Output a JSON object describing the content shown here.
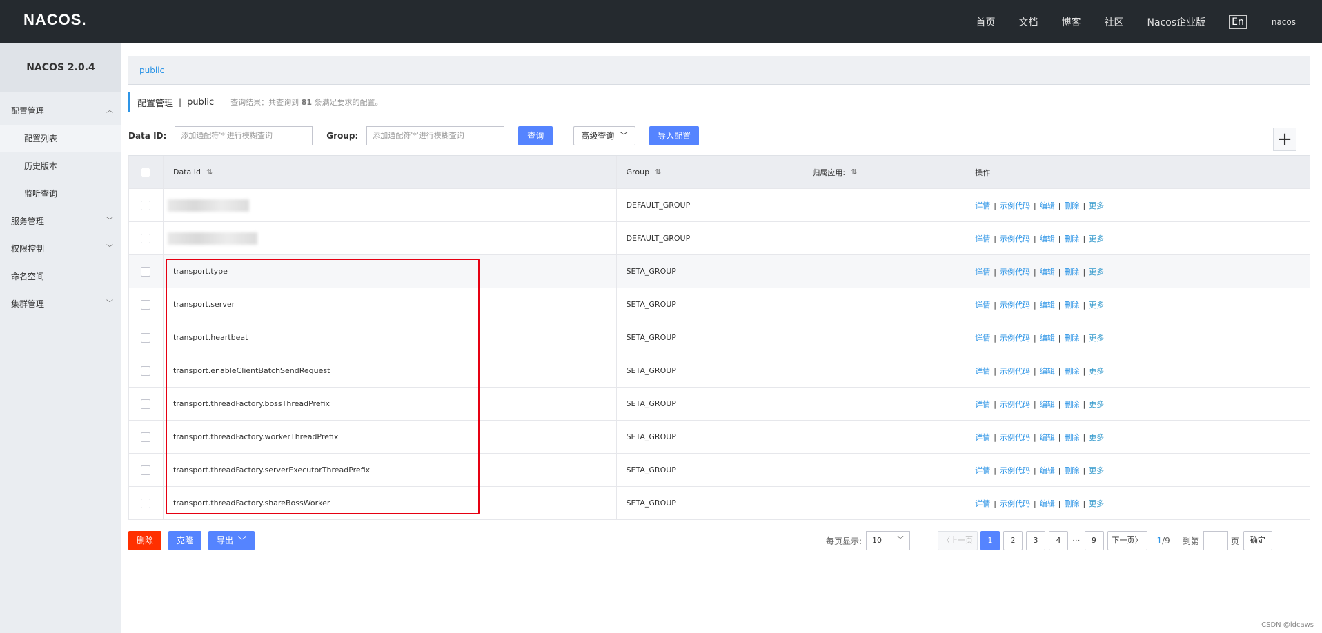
{
  "app": {
    "logo": "NACOS.",
    "nav": [
      "首页",
      "文档",
      "博客",
      "社区",
      "Nacos企业版"
    ],
    "lang": "En",
    "user": "nacos"
  },
  "sidebar": {
    "version": "NACOS 2.0.4",
    "config_mgmt": "配置管理",
    "config_list": "配置列表",
    "history": "历史版本",
    "listen_query": "监听查询",
    "service_mgmt": "服务管理",
    "auth_ctrl": "权限控制",
    "namespace": "命名空间",
    "cluster_mgmt": "集群管理"
  },
  "namespace_bar": {
    "current": "public"
  },
  "title": {
    "section": "配置管理",
    "separator": "|",
    "namespace": "public",
    "query_result_prefix": "查询结果：共查询到",
    "query_count": "81",
    "query_result_suffix": "条满足要求的配置。"
  },
  "search": {
    "data_id_label": "Data ID:",
    "data_id_placeholder": "添加通配符'*'进行模糊查询",
    "group_label": "Group:",
    "group_placeholder": "添加通配符'*'进行模糊查询",
    "query_btn": "查询",
    "advanced_btn": "高级查询",
    "import_btn": "导入配置",
    "add_btn": "+"
  },
  "table": {
    "headers": [
      "Data Id",
      "Group",
      "归属应用:",
      "操作"
    ],
    "sort_icon": "⇅",
    "op_labels": [
      "详情",
      "示例代码",
      "编辑",
      "删除",
      "更多"
    ],
    "op_sep": "|",
    "rows": [
      {
        "data_id": "",
        "group": "DEFAULT_GROUP",
        "app": "",
        "blurred": true
      },
      {
        "data_id": "",
        "group": "DEFAULT_GROUP",
        "app": "",
        "blurred": true
      },
      {
        "data_id": "transport.type",
        "group": "SETA_GROUP",
        "app": ""
      },
      {
        "data_id": "transport.server",
        "group": "SETA_GROUP",
        "app": ""
      },
      {
        "data_id": "transport.heartbeat",
        "group": "SETA_GROUP",
        "app": ""
      },
      {
        "data_id": "transport.enableClientBatchSendRequest",
        "group": "SETA_GROUP",
        "app": ""
      },
      {
        "data_id": "transport.threadFactory.bossThreadPrefix",
        "group": "SETA_GROUP",
        "app": ""
      },
      {
        "data_id": "transport.threadFactory.workerThreadPrefix",
        "group": "SETA_GROUP",
        "app": ""
      },
      {
        "data_id": "transport.threadFactory.serverExecutorThreadPrefix",
        "group": "SETA_GROUP",
        "app": ""
      },
      {
        "data_id": "transport.threadFactory.shareBossWorker",
        "group": "SETA_GROUP",
        "app": ""
      }
    ]
  },
  "bottom": {
    "delete_btn": "删除",
    "clone_btn": "克隆",
    "export_btn": "导出"
  },
  "pager": {
    "per_page_label": "每页显示:",
    "per_page_value": "10",
    "prev": "上一页",
    "pages": [
      "1",
      "2",
      "3",
      "4"
    ],
    "ellipsis": "···",
    "last_page": "9",
    "next": "下一页",
    "current": "1",
    "total": "/9",
    "goto_label": "到第",
    "page_unit": "页",
    "confirm": "确定"
  },
  "watermark": "CSDN @ldcaws",
  "colors": {
    "topbar": "#252a2f",
    "primary": "#5584ff",
    "danger": "#ff3000",
    "link": "#2e95e6",
    "highlight_box": "#e60012"
  }
}
